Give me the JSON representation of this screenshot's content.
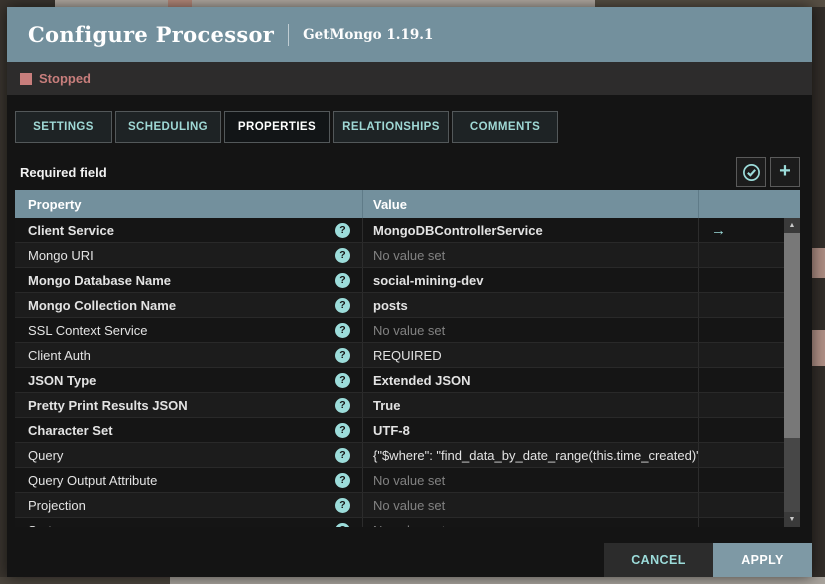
{
  "dialog": {
    "title": "Configure Processor",
    "subtitle": "GetMongo 1.19.1",
    "status": {
      "label": "Stopped",
      "color": "#c87e7c"
    },
    "tabs": [
      {
        "label": "SETTINGS",
        "active": false
      },
      {
        "label": "SCHEDULING",
        "active": false
      },
      {
        "label": "PROPERTIES",
        "active": true
      },
      {
        "label": "RELATIONSHIPS",
        "active": false
      },
      {
        "label": "COMMENTS",
        "active": false
      }
    ],
    "properties_tab": {
      "required_field_label": "Required field",
      "table": {
        "columns": [
          "Property",
          "Value"
        ],
        "rows": [
          {
            "property": "Client Service",
            "value": "MongoDBControllerService",
            "required": true,
            "set": true,
            "value_bold": true,
            "has_goto": true
          },
          {
            "property": "Mongo URI",
            "value": "No value set",
            "required": false,
            "set": false,
            "value_bold": false,
            "has_goto": false
          },
          {
            "property": "Mongo Database Name",
            "value": "social-mining-dev",
            "required": true,
            "set": true,
            "value_bold": true,
            "has_goto": false
          },
          {
            "property": "Mongo Collection Name",
            "value": "posts",
            "required": true,
            "set": true,
            "value_bold": true,
            "has_goto": false
          },
          {
            "property": "SSL Context Service",
            "value": "No value set",
            "required": false,
            "set": false,
            "value_bold": false,
            "has_goto": false
          },
          {
            "property": "Client Auth",
            "value": "REQUIRED",
            "required": false,
            "set": true,
            "value_bold": false,
            "has_goto": false
          },
          {
            "property": "JSON Type",
            "value": "Extended JSON",
            "required": true,
            "set": true,
            "value_bold": true,
            "has_goto": false
          },
          {
            "property": "Pretty Print Results JSON",
            "value": "True",
            "required": true,
            "set": true,
            "value_bold": true,
            "has_goto": false
          },
          {
            "property": "Character Set",
            "value": "UTF-8",
            "required": true,
            "set": true,
            "value_bold": true,
            "has_goto": false
          },
          {
            "property": "Query",
            "value": "{\"$where\": \"find_data_by_date_range(this.time_created)\"}",
            "required": false,
            "set": true,
            "value_bold": false,
            "has_goto": false
          },
          {
            "property": "Query Output Attribute",
            "value": "No value set",
            "required": false,
            "set": false,
            "value_bold": false,
            "has_goto": false
          },
          {
            "property": "Projection",
            "value": "No value set",
            "required": false,
            "set": false,
            "value_bold": false,
            "has_goto": false
          },
          {
            "property": "Sort",
            "value": "No value set",
            "required": false,
            "set": false,
            "value_bold": false,
            "has_goto": false
          }
        ]
      }
    },
    "buttons": {
      "cancel": "CANCEL",
      "apply": "APPLY"
    },
    "icons": {
      "verify": "check-circle-icon",
      "add": "plus-icon",
      "add_glyph": "+",
      "help": "question-circle-icon",
      "help_glyph": "?",
      "goto_glyph": "→",
      "scroll_up_glyph": "▲",
      "scroll_down_glyph": "▼"
    },
    "colors": {
      "accent_teal": "#9cdcda",
      "header_bg": "#73909d",
      "status_pink": "#c87e7c",
      "apply_bg": "#7e99a5"
    }
  }
}
